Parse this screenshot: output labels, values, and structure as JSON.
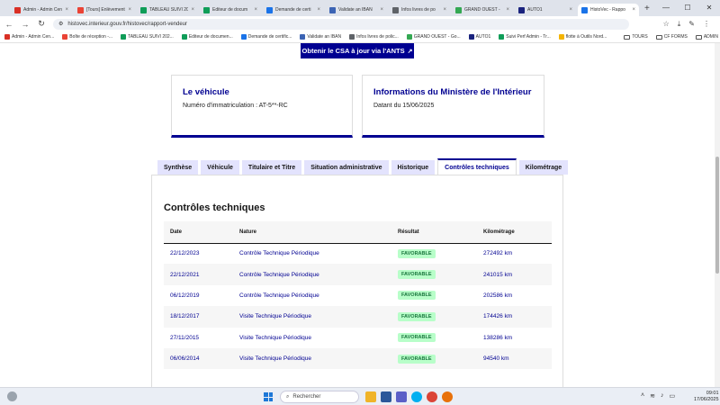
{
  "browser": {
    "tabs": [
      {
        "label": "Admin - Admin Cen",
        "color": "#d93025",
        "active": false
      },
      {
        "label": "[Tours] Enlèvement",
        "color": "#ea4335",
        "active": false
      },
      {
        "label": "TABLEAU SUIVI 20",
        "color": "#0f9d58",
        "active": false
      },
      {
        "label": "Editeur de docum",
        "color": "#0f9d58",
        "active": false
      },
      {
        "label": "Demande de certi",
        "color": "#1a73e8",
        "active": false
      },
      {
        "label": "Validate an IBAN",
        "color": "#3c64b4",
        "active": false
      },
      {
        "label": "Infos livres de po",
        "color": "#5f6368",
        "active": false
      },
      {
        "label": "GRAND OUEST -",
        "color": "#34a853",
        "active": false
      },
      {
        "label": "AUTO1",
        "color": "#1a237e",
        "active": false
      },
      {
        "label": "HistoVec - Rappo",
        "color": "#1a73e8",
        "active": true
      }
    ],
    "new_tab": "+",
    "window_controls": {
      "minimize": "—",
      "maximize": "☐",
      "close": "✕"
    },
    "url": "histovec.interieur.gouv.fr/histovec/rapport-vendeur",
    "back": "←",
    "forward": "→",
    "reload": "↻"
  },
  "bookmarks": [
    {
      "label": "Admin - Admin Cen...",
      "color": "#d93025"
    },
    {
      "label": "Boîte de réception -...",
      "color": "#ea4335"
    },
    {
      "label": "TABLEAU SUIVI 202...",
      "color": "#0f9d58"
    },
    {
      "label": "Editeur de documen...",
      "color": "#0f9d58"
    },
    {
      "label": "Demande de certific...",
      "color": "#1a73e8"
    },
    {
      "label": "Validate an IBAN",
      "color": "#3c64b4"
    },
    {
      "label": "Infos livres de polic...",
      "color": "#5f6368"
    },
    {
      "label": "GRAND OUEST - Go...",
      "color": "#34a853"
    },
    {
      "label": "AUTO1",
      "color": "#1a237e"
    },
    {
      "label": "Suivi Perf Admin - Tr...",
      "color": "#0f9d58"
    },
    {
      "label": "flotte à Outils Nord...",
      "color": "#f4b400"
    }
  ],
  "bookmark_folders": [
    "TOURS",
    "CF FORMS",
    "ADMIN"
  ],
  "page": {
    "csa_button": "Obtenir le CSA à jour via l'ANTS",
    "vehicle_card": {
      "title": "Le véhicule",
      "subtitle": "Numéro d'immatriculation : AT-5**-RC"
    },
    "ministry_card": {
      "title": "Informations du Ministère de l'Intérieur",
      "subtitle": "Datant du 15/06/2025"
    },
    "tabs": [
      "Synthèse",
      "Véhicule",
      "Titulaire et Titre",
      "Situation administrative",
      "Historique",
      "Contrôles techniques",
      "Kilométrage"
    ],
    "active_tab": "Contrôles techniques",
    "section_title": "Contrôles techniques",
    "table": {
      "headers": [
        "Date",
        "Nature",
        "Résultat",
        "Kilométrage"
      ],
      "rows": [
        [
          "22/12/2023",
          "Contrôle Technique Périodique",
          "FAVORABLE",
          "272492 km"
        ],
        [
          "22/12/2021",
          "Contrôle Technique Périodique",
          "FAVORABLE",
          "241015 km"
        ],
        [
          "06/12/2019",
          "Contrôle Technique Périodique",
          "FAVORABLE",
          "202586 km"
        ],
        [
          "18/12/2017",
          "Visite Technique Périodique",
          "FAVORABLE",
          "174426 km"
        ],
        [
          "27/11/2015",
          "Visite Technique Périodique",
          "FAVORABLE",
          "138286 km"
        ],
        [
          "06/06/2014",
          "Visite Technique Périodique",
          "FAVORABLE",
          "94540 km"
        ]
      ]
    }
  },
  "taskbar": {
    "search_placeholder": "Rechercher",
    "time": "09:01",
    "date": "17/06/2025"
  },
  "colors": {
    "brand_blue": "#000091",
    "favorable_bg": "#b8fec9",
    "favorable_text": "#18753c"
  }
}
